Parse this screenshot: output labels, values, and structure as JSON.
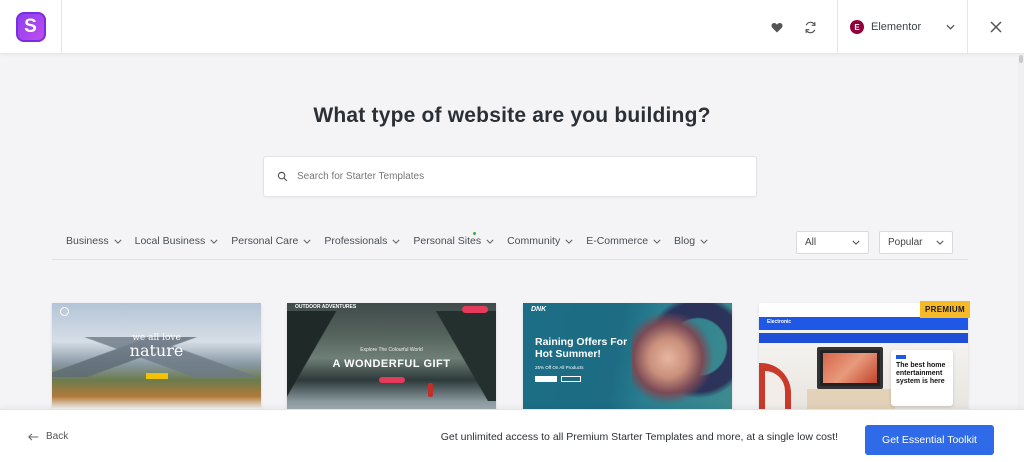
{
  "header": {
    "logo_letter": "S",
    "builder_badge": "E",
    "builder_label": "Elementor"
  },
  "main": {
    "heading": "What type of website are you building?",
    "search_placeholder": "Search for Starter Templates"
  },
  "filters": {
    "categories": [
      {
        "label": "Business"
      },
      {
        "label": "Local Business"
      },
      {
        "label": "Personal Care"
      },
      {
        "label": "Professionals"
      },
      {
        "label": "Personal Sites"
      },
      {
        "label": "Community"
      },
      {
        "label": "E-Commerce"
      },
      {
        "label": "Blog"
      }
    ],
    "type_select": "All",
    "sort_select": "Popular"
  },
  "templates": [
    {
      "hero_small": "we all love",
      "hero_big": "nature"
    },
    {
      "brand": "OUTDOOR ADVENTURES",
      "tagline": "Explore The Colourful World",
      "headline": "A WONDERFUL GIFT"
    },
    {
      "brand": "DNK",
      "headline_line1": "Raining Offers For",
      "headline_line2": "Hot Summer!",
      "sub": "25% Off On All Products"
    },
    {
      "brand": "Electronic",
      "info_title": "The best home entertainment system is here",
      "badge": "PREMIUM"
    }
  ],
  "footer": {
    "back_label": "Back",
    "promo_text": "Get unlimited access to all Premium Starter Templates and more, at a single low cost!",
    "cta_label": "Get Essential Toolkit"
  },
  "colors": {
    "accent": "#2f6be8",
    "premium": "#f6b928",
    "logo": "#8a3ff0",
    "elementor": "#92003b"
  }
}
